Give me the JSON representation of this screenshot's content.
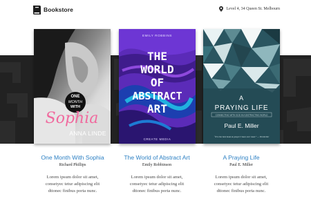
{
  "header": {
    "brand": "Bookstore",
    "address": "Level 4, 34 Queen St. Melbourn"
  },
  "books": [
    {
      "title": "One Month With Sophia",
      "author": "Richard Phillips",
      "description": [
        "Lorem ipsum dolor sit amet,",
        "consetyec tetur adipiscing elit",
        "dttonec finibus porta nunc."
      ],
      "cover": {
        "badge_lines": [
          "ONE",
          "MONTH",
          "WITH"
        ],
        "script_title": "Sophia",
        "author_name": "ANNA LINDE"
      }
    },
    {
      "title": "The World of Abstract Art",
      "author": "Emily Robbinson",
      "description": [
        "Lorem ipsum dolor sit amet,",
        "consetyec tetur adipiscing elit",
        "dttonec finibus porta nunc."
      ],
      "cover": {
        "top_text": "EMILY ROBBINS",
        "title_lines": [
          "THE",
          "WORLD",
          "OF",
          "ABSTRACT",
          "ART"
        ],
        "bottom_text": "CREATE MEDIA"
      }
    },
    {
      "title": "A Praying Life",
      "author": "Paul E. Miller",
      "description": [
        "Lorem ipsum dolor sit amet,",
        "consetyec tetur adipiscing elit",
        "dttonec finibus porta nunc."
      ],
      "cover": {
        "title_lines": [
          "A",
          "PRAYING LIFE"
        ],
        "subtitle": "CONNECTING WITH GOD IN A DISTRACTING WORLD",
        "author_name": "Paul E. Miller",
        "blurb": "“It is the best book on prayer I have ever read.” — Tim Keller"
      }
    }
  ],
  "colors": {
    "link": "#2b7fc3",
    "band": "#222222",
    "cover2_purple": "#5b2bb8",
    "cover3_teal": "#2a5560"
  }
}
